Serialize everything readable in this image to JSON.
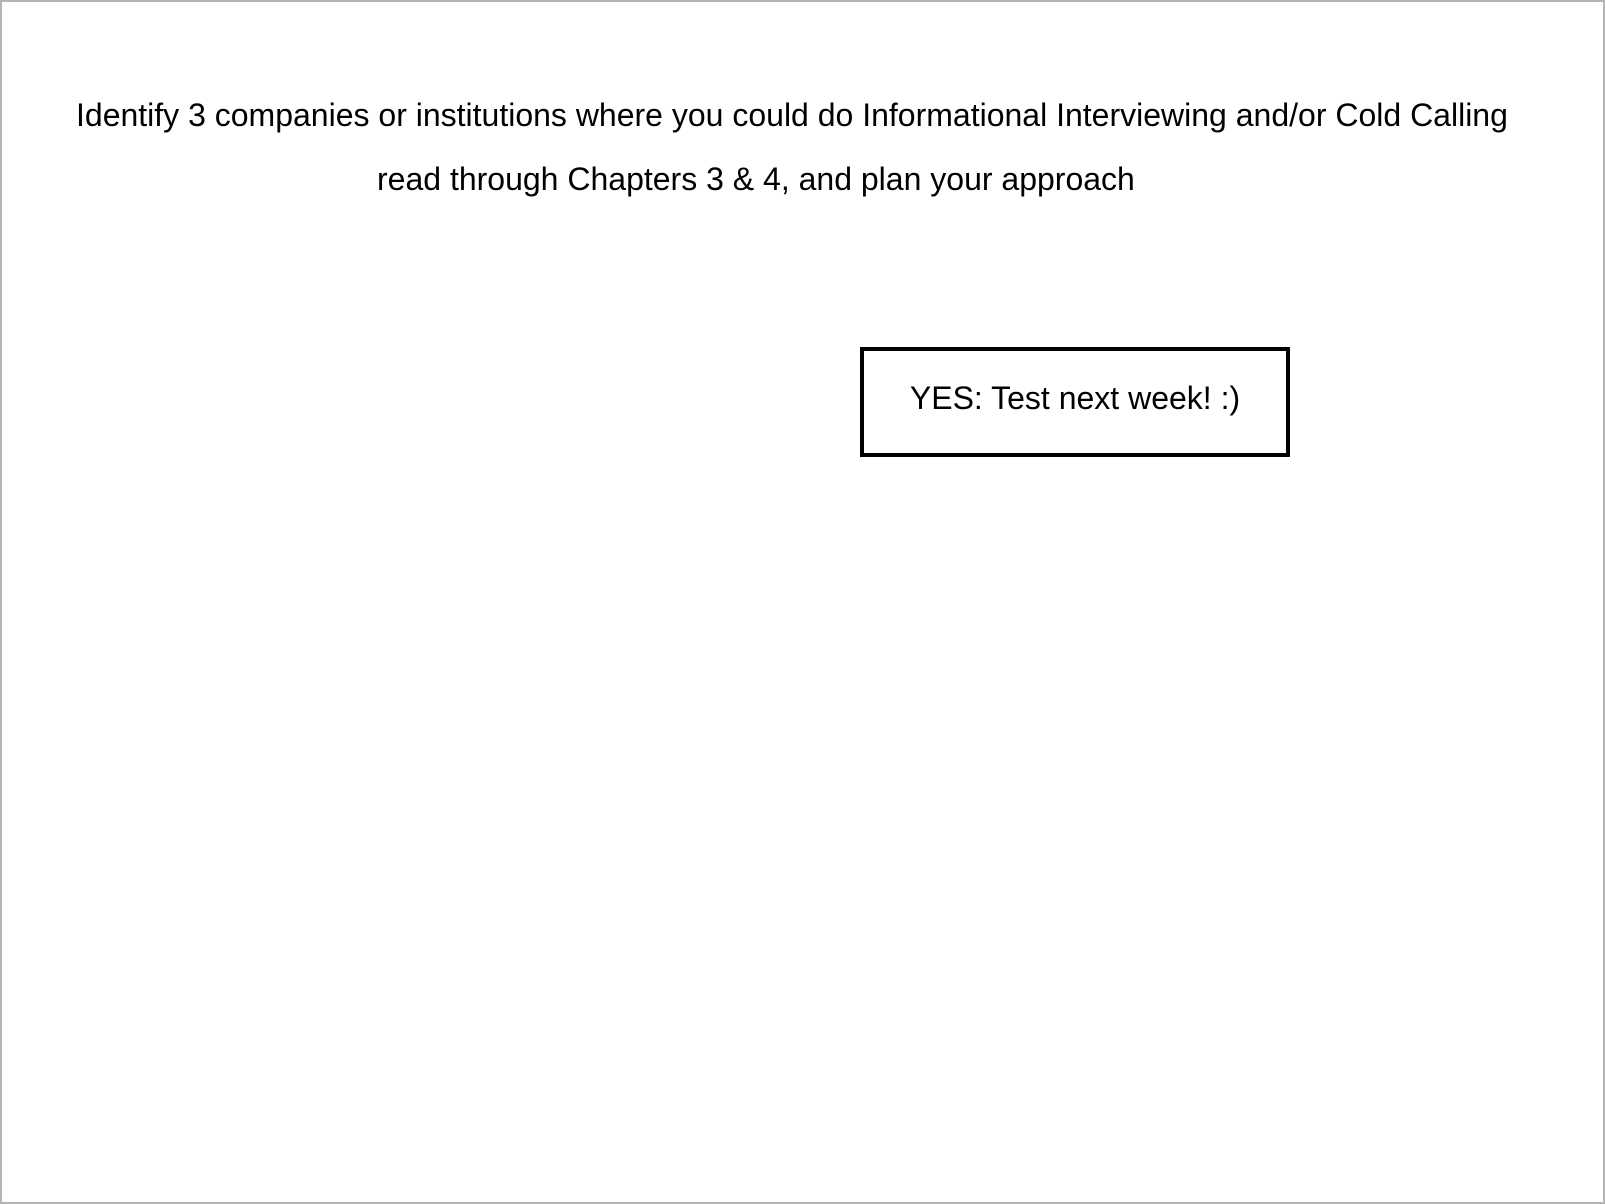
{
  "document": {
    "lines": [
      "Identify 3 companies or institutions where you could do Informational Interviewing and/or Cold Calling",
      "read through Chapters 3 & 4, and plan your approach"
    ],
    "note_box": {
      "text": "YES: Test next week! :)"
    }
  },
  "colors": {
    "text": "#000000",
    "page_border": "#b4b4b4",
    "background": "#ffffff"
  }
}
